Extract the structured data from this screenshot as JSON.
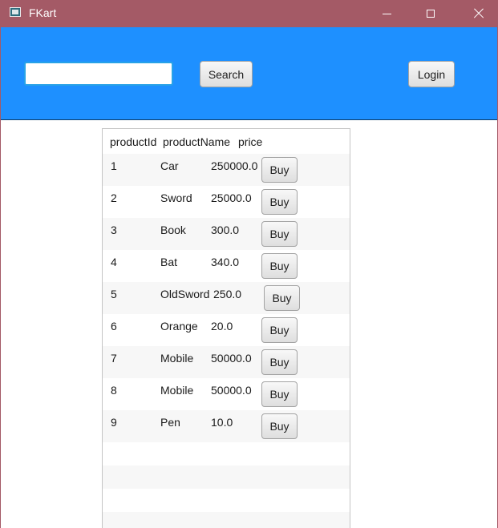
{
  "window": {
    "title": "FKart",
    "controls": [
      "minimize",
      "maximize",
      "close"
    ]
  },
  "header": {
    "search": {
      "value": "",
      "placeholder": ""
    },
    "search_button_label": "Search",
    "login_button_label": "Login",
    "background_color": "#1e90ff",
    "titlebar_color": "#a45a66"
  },
  "table": {
    "columns": [
      "productId",
      "productName",
      "price"
    ],
    "rows": [
      {
        "productId": "1",
        "productName": "Car",
        "price": "250000.0",
        "action": "Buy"
      },
      {
        "productId": "2",
        "productName": "Sword",
        "price": "25000.0",
        "action": "Buy"
      },
      {
        "productId": "3",
        "productName": "Book",
        "price": "300.0",
        "action": "Buy"
      },
      {
        "productId": "4",
        "productName": "Bat",
        "price": "340.0",
        "action": "Buy"
      },
      {
        "productId": "5",
        "productName": "OldSword",
        "price": "250.0",
        "action": "Buy"
      },
      {
        "productId": "6",
        "productName": "Orange",
        "price": "20.0",
        "action": "Buy"
      },
      {
        "productId": "7",
        "productName": "Mobile",
        "price": "50000.0",
        "action": "Buy"
      },
      {
        "productId": "8",
        "productName": "Mobile",
        "price": "50000.0",
        "action": "Buy"
      },
      {
        "productId": "9",
        "productName": "Pen",
        "price": "10.0",
        "action": "Buy"
      }
    ]
  }
}
